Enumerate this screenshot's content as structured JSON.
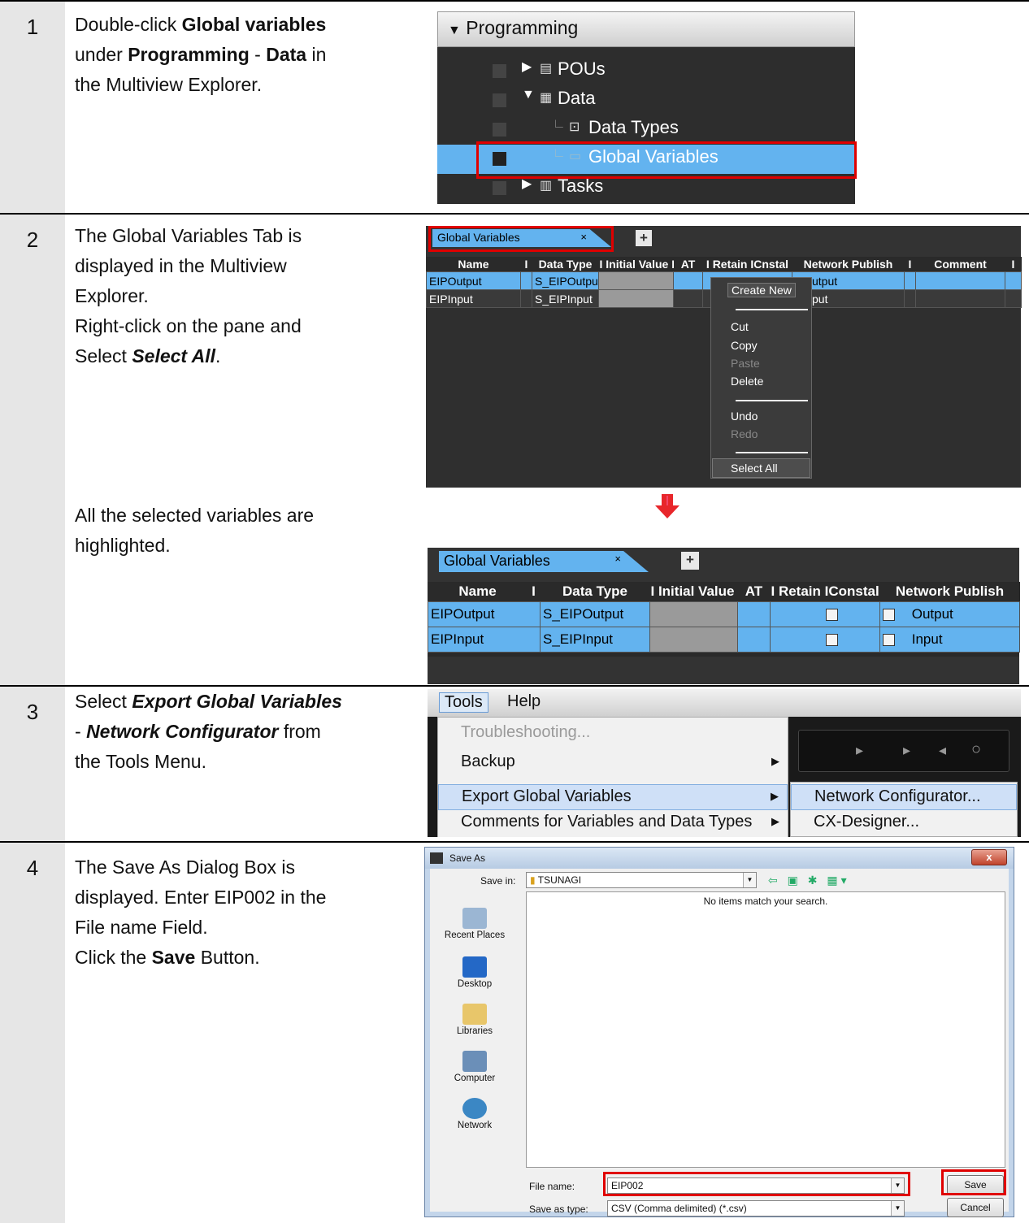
{
  "steps": [
    {
      "num": "1"
    },
    {
      "num": "2"
    },
    {
      "num": "3"
    },
    {
      "num": "4"
    }
  ],
  "step1": {
    "t1": "Double-click ",
    "b1": "Global variables",
    "t2": "under ",
    "b2": "Programming",
    "t3": " - ",
    "b3": "Data",
    "t4": " in",
    "t5": "the Multiview Explorer.",
    "tree": {
      "header": "Programming",
      "pous": "POUs",
      "data": "Data",
      "data_types": "Data Types",
      "global_variables": "Global Variables",
      "tasks": "Tasks"
    }
  },
  "step2": {
    "l1": "The Global Variables Tab is",
    "l2": "displayed in the Multiview",
    "l3": "Explorer.",
    "l4": "Right-click on the pane and",
    "l5a": "Select ",
    "l5b": "Select All",
    "l5c": ".",
    "l6": "All the selected variables are",
    "l7": "highlighted.",
    "tab_label": "Global Variables",
    "tab_close": "×",
    "plus": "+",
    "columns": [
      "Name",
      "I",
      "Data Type",
      "I Initial Value I",
      "AT",
      "I Retain ICnstal",
      "Network Publish",
      "I",
      "Comment",
      "I"
    ],
    "columns2": [
      "Name",
      "I",
      "Data Type",
      "I Initial Value I",
      "AT",
      "I Retain IConstal",
      "Network Publish"
    ],
    "rows": [
      {
        "name": "EIPOutput",
        "type": "S_EIPOutput",
        "publish": "Output",
        "publish_partial": "utput"
      },
      {
        "name": "EIPInput",
        "type": "S_EIPInput",
        "publish": "Input",
        "publish_partial": "put"
      }
    ],
    "context_menu": {
      "create_new": "Create New",
      "cut": "Cut",
      "copy": "Copy",
      "paste": "Paste",
      "delete": "Delete",
      "undo": "Undo",
      "redo": "Redo",
      "select_all": "Select All"
    }
  },
  "step3": {
    "t1": "Select ",
    "b1": "Export Global Variables",
    "t2": "- ",
    "b2": "Network Configurator",
    "t3": " from",
    "t4": "the Tools Menu.",
    "menubar": {
      "tools": "Tools",
      "help": "Help"
    },
    "menu": {
      "troubleshooting": "Troubleshooting...",
      "backup": "Backup",
      "export": "Export Global Variables",
      "comments": "Comments for Variables and Data Types"
    },
    "submenu": {
      "network_configurator": "Network Configurator...",
      "cx_designer": "CX-Designer..."
    }
  },
  "step4": {
    "l1": "The Save As Dialog Box is",
    "l2": "displayed. Enter EIP002 in the",
    "l3": "File name Field.",
    "l4a": "Click the ",
    "l4b": "Save",
    "l4c": " Button.",
    "dialog": {
      "title": "Save As",
      "save_in_label": "Save in:",
      "save_in_value": "TSUNAGI",
      "empty_msg": "No items match your search.",
      "places": [
        "Recent Places",
        "Desktop",
        "Libraries",
        "Computer",
        "Network"
      ],
      "file_name_label": "File name:",
      "file_name_value": "EIP002",
      "save_type_label": "Save as type:",
      "save_type_value": "CSV (Comma delimited) (*.csv)",
      "save_button": "Save",
      "cancel_button": "Cancel"
    }
  },
  "colors": {
    "highlight_red": "#e00000",
    "selection_blue": "#63b3ef",
    "arrow_red": "#e8262b"
  }
}
